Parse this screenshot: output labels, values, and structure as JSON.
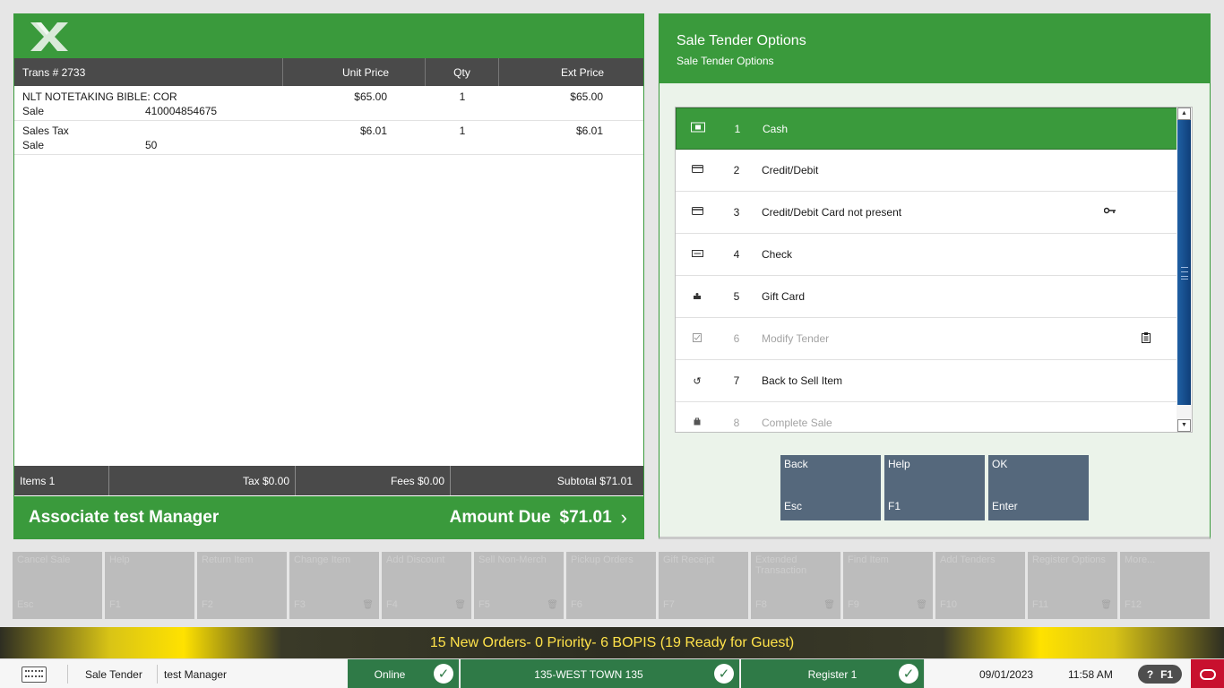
{
  "transaction": {
    "headers": {
      "trans_label": "Trans #  2733",
      "unit_price": "Unit Price",
      "qty": "Qty",
      "ext_price": "Ext Price"
    },
    "items": [
      {
        "name": "NLT NOTETAKING BIBLE: COR",
        "type": "Sale",
        "code": "410004854675",
        "unit_price": "$65.00",
        "qty": "1",
        "ext_price": "$65.00"
      },
      {
        "name": "Sales Tax",
        "type": "Sale",
        "code": "50",
        "unit_price": "$6.01",
        "qty": "1",
        "ext_price": "$6.01"
      }
    ],
    "footer": {
      "items": "Items 1",
      "tax": "Tax $0.00",
      "fees": "Fees $0.00",
      "subtotal": "Subtotal $71.01"
    },
    "associate": "Associate test Manager",
    "amount_due_label": "Amount Due",
    "amount_due_value": "$71.01"
  },
  "tender": {
    "title": "Sale Tender Options",
    "subtitle": "Sale Tender Options",
    "options": [
      {
        "num": "1",
        "label": "Cash",
        "icon": "cash-icon",
        "selected": true,
        "disabled": false
      },
      {
        "num": "2",
        "label": "Credit/Debit",
        "icon": "card-icon",
        "selected": false,
        "disabled": false
      },
      {
        "num": "3",
        "label": "Credit/Debit Card not present",
        "icon": "card-icon",
        "selected": false,
        "disabled": false,
        "extra_icon": "key-icon"
      },
      {
        "num": "4",
        "label": "Check",
        "icon": "check-icon",
        "selected": false,
        "disabled": false
      },
      {
        "num": "5",
        "label": "Gift Card",
        "icon": "gift-icon",
        "selected": false,
        "disabled": false
      },
      {
        "num": "6",
        "label": "Modify Tender",
        "icon": "modify-icon",
        "selected": false,
        "disabled": true,
        "extra_icon": "clipboard-icon"
      },
      {
        "num": "7",
        "label": "Back to Sell Item",
        "icon": "undo-icon",
        "selected": false,
        "disabled": false
      },
      {
        "num": "8",
        "label": "Complete Sale",
        "icon": "bag-icon",
        "selected": false,
        "disabled": true
      }
    ],
    "buttons": [
      {
        "label": "Back",
        "key": "Esc"
      },
      {
        "label": "Help",
        "key": "F1"
      },
      {
        "label": "OK",
        "key": "Enter"
      }
    ]
  },
  "fkeys": [
    {
      "label": "Cancel Sale",
      "key": "Esc",
      "trash": false
    },
    {
      "label": "Help",
      "key": "F1",
      "trash": false
    },
    {
      "label": "Return Item",
      "key": "F2",
      "trash": false
    },
    {
      "label": "Change Item",
      "key": "F3",
      "trash": true
    },
    {
      "label": "Add Discount",
      "key": "F4",
      "trash": true
    },
    {
      "label": "Sell Non-Merch",
      "key": "F5",
      "trash": true
    },
    {
      "label": "Pickup Orders",
      "key": "F6",
      "trash": false
    },
    {
      "label": "Gift Receipt",
      "key": "F7",
      "trash": false
    },
    {
      "label": "Extended Transaction",
      "key": "F8",
      "trash": true
    },
    {
      "label": "Find Item",
      "key": "F9",
      "trash": true
    },
    {
      "label": "Add Tenders",
      "key": "F10",
      "trash": false
    },
    {
      "label": "Register Options",
      "key": "F11",
      "trash": true
    },
    {
      "label": "More...",
      "key": "F12",
      "trash": false
    }
  ],
  "notification": "15 New Orders- 0 Priority- 6 BOPIS (19 Ready for Guest)",
  "status": {
    "screen": "Sale Tender",
    "user": "test Manager",
    "online": "Online",
    "store": "135-WEST TOWN 135",
    "register": "Register 1",
    "date": "09/01/2023",
    "time": "11:58 AM",
    "help_q": "?",
    "help_key": "F1"
  },
  "colors": {
    "brand_green": "#3a9a3c",
    "dark_header": "#4a4a4a",
    "button_slate": "#55687c",
    "status_green": "#2f7a47",
    "oracle_red": "#c8102e"
  }
}
